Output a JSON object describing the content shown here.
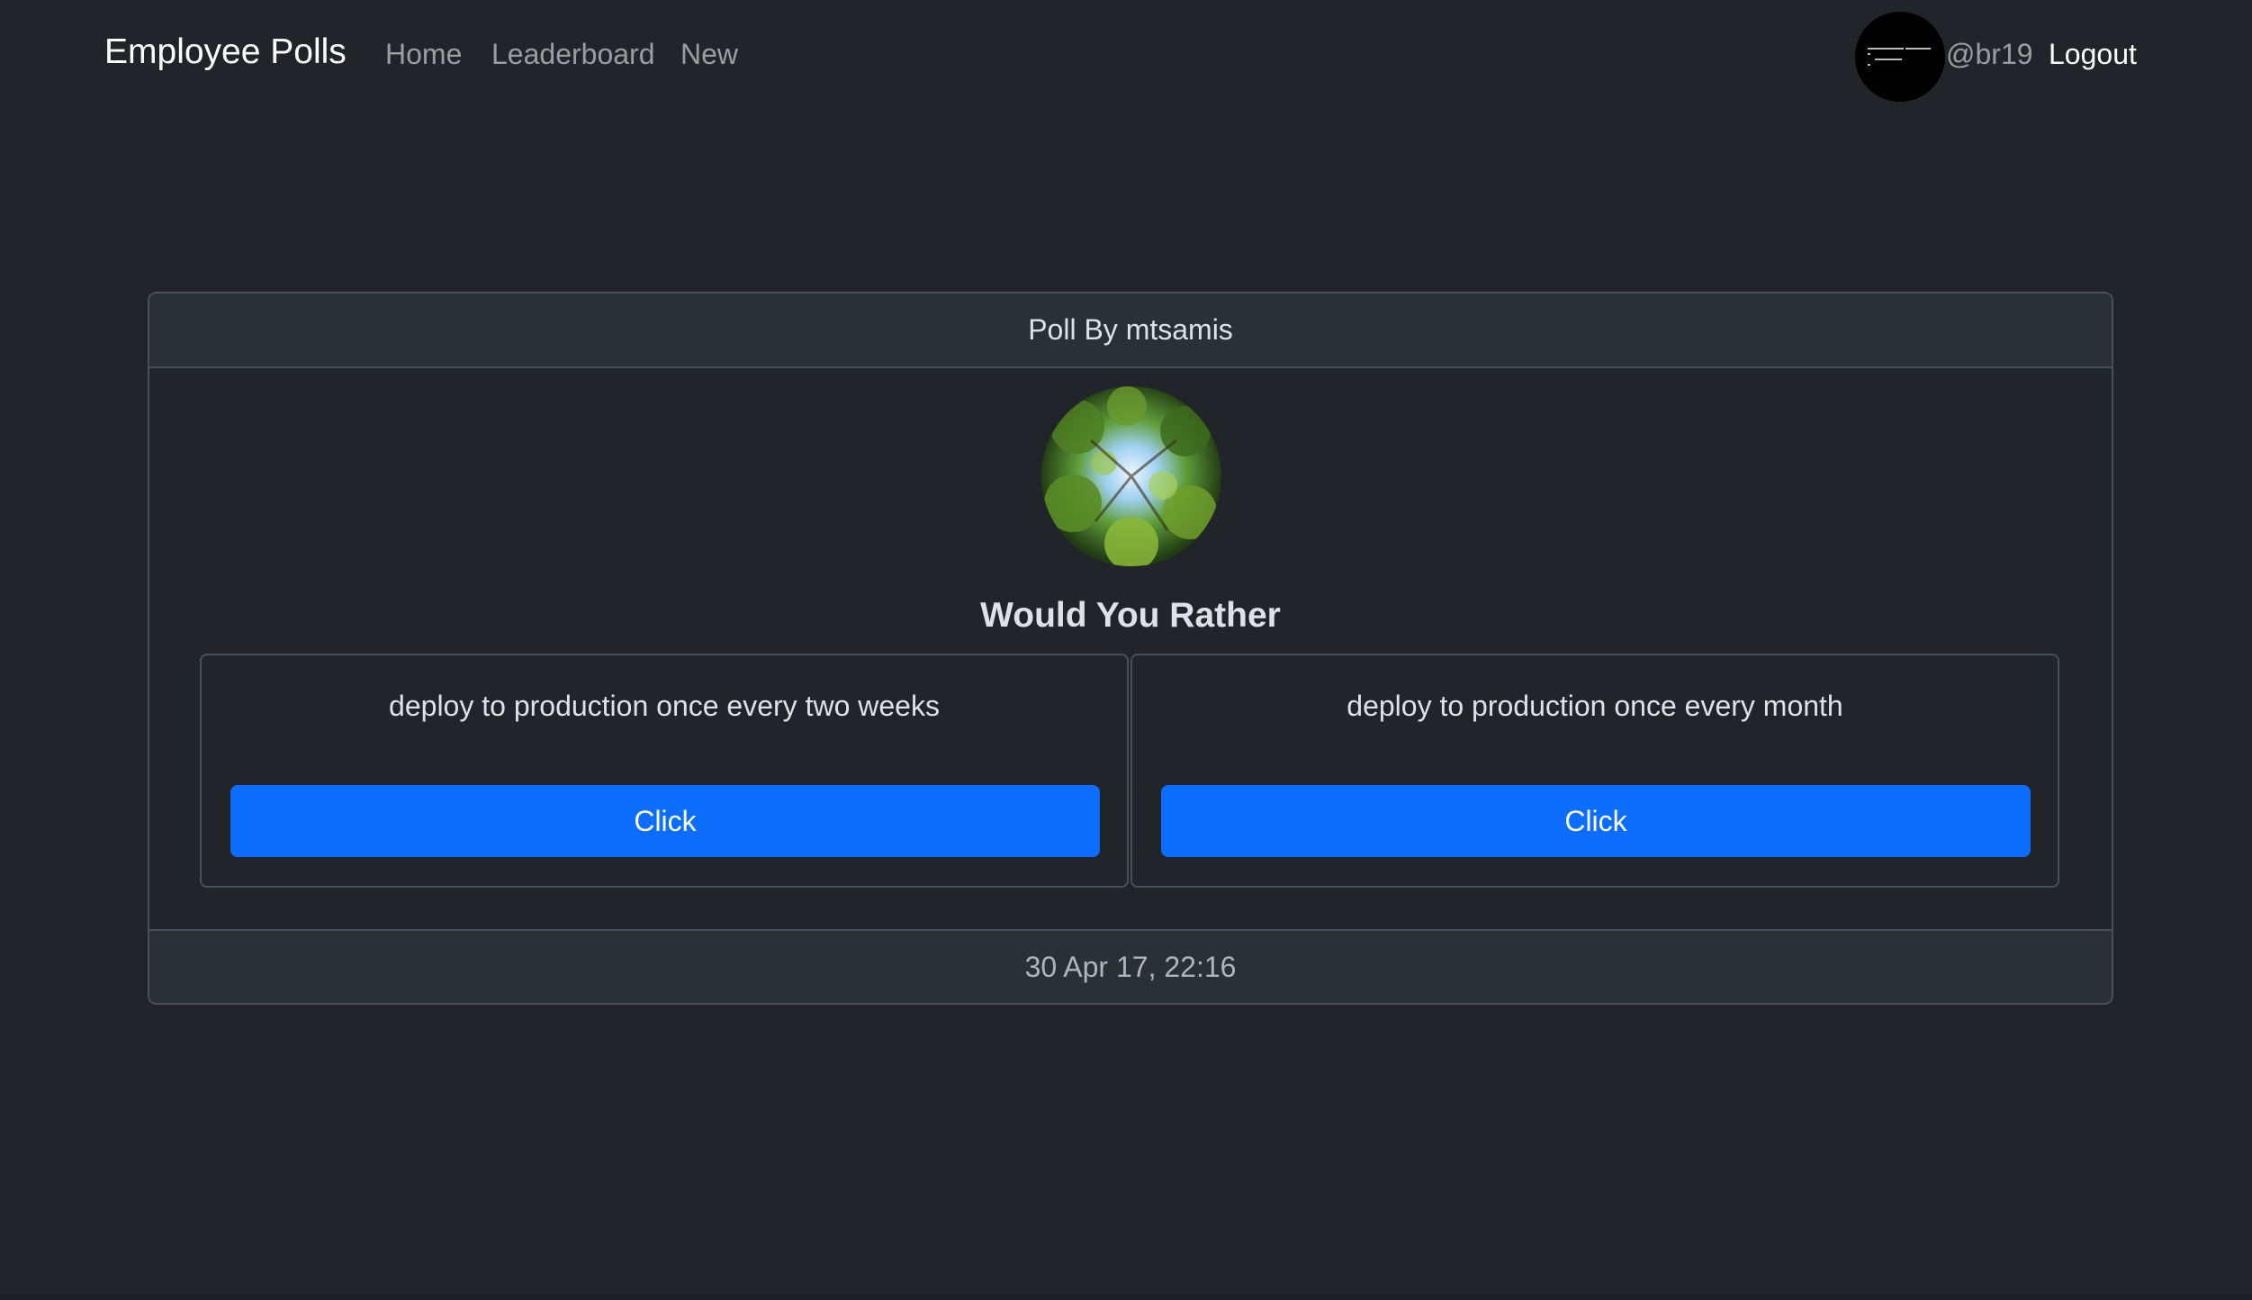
{
  "nav": {
    "brand": "Employee Polls",
    "links": {
      "home": "Home",
      "leaderboard": "Leaderboard",
      "new": "New"
    },
    "user": {
      "handle": "@br19",
      "avatar_icon": "code-avatar-icon"
    },
    "logout": "Logout"
  },
  "poll": {
    "header": "Poll By mtsamis",
    "avatar_icon": "tree-canopy-avatar",
    "title": "Would You Rather",
    "options": [
      {
        "text": "deploy to production once every two weeks",
        "button": "Click"
      },
      {
        "text": "deploy to production once every month",
        "button": "Click"
      }
    ],
    "timestamp": "30 Apr 17, 22:16"
  },
  "colors": {
    "background": "#212529",
    "card_header": "#2b3035",
    "border": "#495057",
    "primary": "#0d6efd"
  }
}
